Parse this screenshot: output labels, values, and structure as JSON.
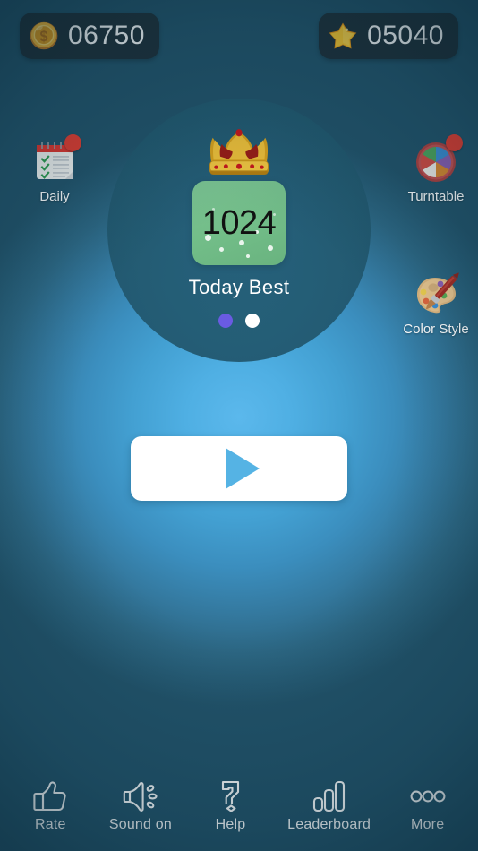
{
  "theme": {
    "bg_center": "#5BB8EC",
    "bg_edge": "#22536A",
    "counter_bg": "#1e2f38",
    "tile_green": "#72BD88",
    "play_accent": "#55B3E4",
    "badge_red": "#E53B2E",
    "dot_active": "#6A5BE2",
    "dot_inactive": "#FFFFFF"
  },
  "topbar": {
    "coins": {
      "icon": "coin-icon",
      "value": "06750"
    },
    "stars": {
      "icon": "star-icon",
      "value": "05040"
    }
  },
  "hero": {
    "crown_icon": "crown-icon",
    "score": "1024",
    "caption": "Today Best",
    "pager": {
      "total": 2,
      "active_index": 0
    }
  },
  "shortcuts": [
    {
      "id": "daily",
      "label": "Daily",
      "icon": "calendar-checklist-icon",
      "badge": true
    },
    {
      "id": "turntable",
      "label": "Turntable",
      "icon": "color-wheel-icon",
      "badge": true
    },
    {
      "id": "color-style",
      "label": "Color Style",
      "icon": "palette-brush-icon",
      "badge": false
    }
  ],
  "play": {
    "icon": "play-triangle-icon",
    "label": ""
  },
  "bottom_nav": [
    {
      "id": "rate",
      "label": "Rate",
      "icon": "thumbs-up-icon"
    },
    {
      "id": "sound",
      "label": "Sound on",
      "icon": "speaker-on-icon"
    },
    {
      "id": "help",
      "label": "Help",
      "icon": "question-mark-icon"
    },
    {
      "id": "leaderboard",
      "label": "Leaderboard",
      "icon": "bar-chart-icon"
    },
    {
      "id": "more",
      "label": "More",
      "icon": "ellipsis-icon"
    }
  ]
}
